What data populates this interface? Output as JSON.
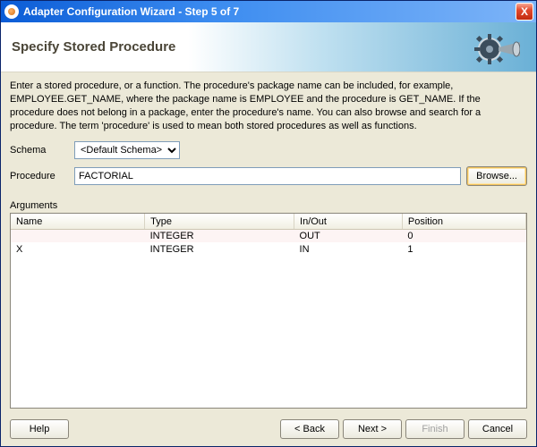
{
  "titlebar": {
    "title": "Adapter Configuration Wizard - Step 5 of 7",
    "close_glyph": "X"
  },
  "banner": {
    "heading": "Specify Stored Procedure"
  },
  "instructions": "Enter a stored procedure, or a function. The procedure's package name can be included, for example, EMPLOYEE.GET_NAME, where the package name is EMPLOYEE and the procedure is GET_NAME.  If the procedure does not belong in a package, enter the procedure's name. You can also browse and search for a procedure. The term 'procedure' is used to mean both stored procedures as well as functions.",
  "form": {
    "schema_label": "Schema",
    "schema_value": "<Default Schema>",
    "procedure_label": "Procedure",
    "procedure_value": "FACTORIAL",
    "browse_label": "Browse..."
  },
  "args": {
    "section_label": "Arguments",
    "headers": {
      "name": "Name",
      "type": "Type",
      "inout": "In/Out",
      "position": "Position"
    },
    "rows": [
      {
        "name": "",
        "type": "INTEGER",
        "inout": "OUT",
        "position": "0"
      },
      {
        "name": "X",
        "type": "INTEGER",
        "inout": "IN",
        "position": "1"
      }
    ]
  },
  "footer": {
    "help": "Help",
    "back": "< Back",
    "next": "Next >",
    "finish": "Finish",
    "cancel": "Cancel"
  }
}
